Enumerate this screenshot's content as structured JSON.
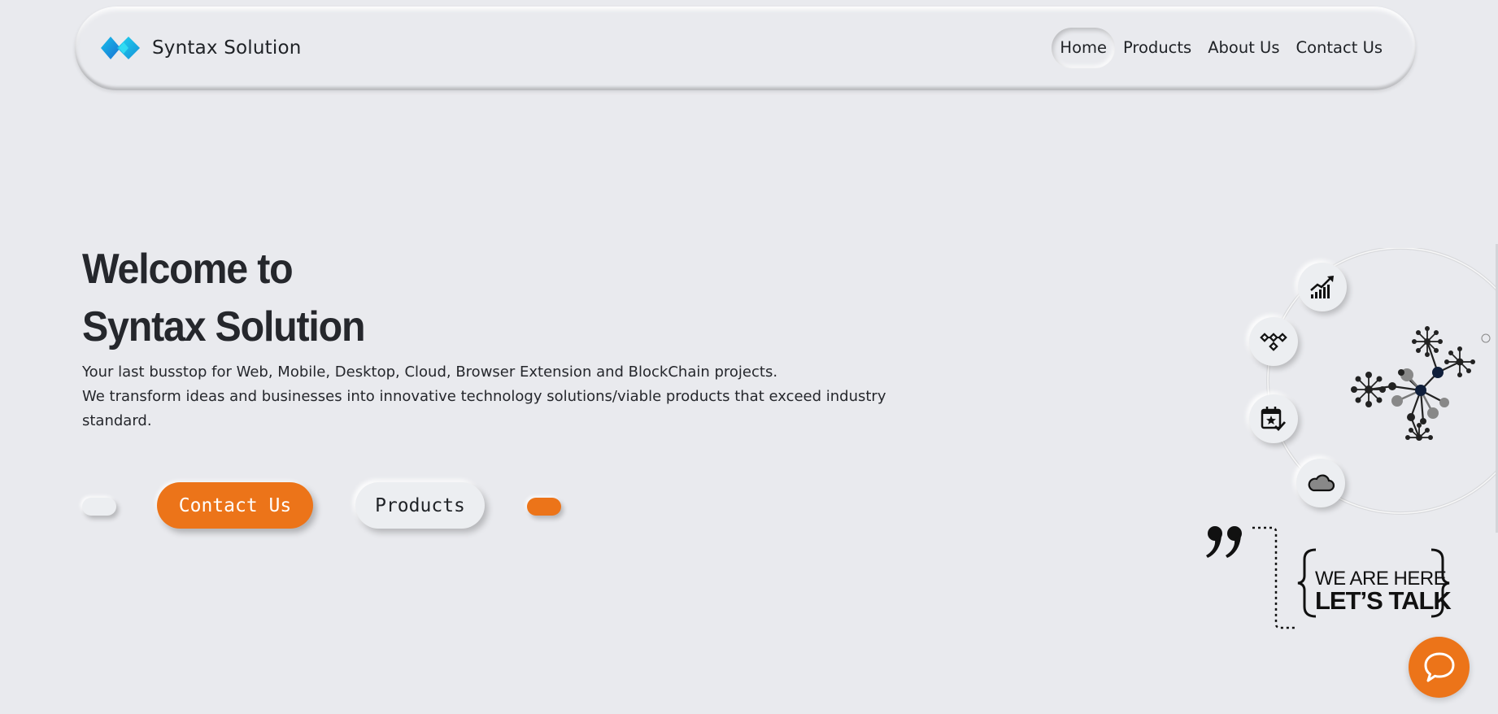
{
  "navbar": {
    "brand_name": "Syntax Solution",
    "logo_icon": "diamond-logo-icon",
    "links": [
      {
        "label": "Home",
        "active": true
      },
      {
        "label": "Products",
        "active": false
      },
      {
        "label": "About Us",
        "active": false
      },
      {
        "label": "Contact Us",
        "active": false
      }
    ]
  },
  "hero": {
    "title_line1": "Welcome to",
    "title_line2": "Syntax Solution",
    "description_line1": "Your last busstop for Web, Mobile, Desktop, Cloud, Browser Extension and BlockChain projects.",
    "description_line2": "We transform ideas and businesses into innovative technology solutions/viable products that exceed industry standard.",
    "contact_button": "Contact Us",
    "products_button": "Products"
  },
  "illustration": {
    "orbit_icons": [
      "chart-growth-icon",
      "blockchain-nodes-icon",
      "calendar-star-icon",
      "cloud-icon"
    ],
    "network_icon": "network-hub-icon",
    "quote_icon": "quote-mark-icon",
    "tagline_line1": "WE ARE HERE",
    "tagline_line2": "LET’S TALK"
  },
  "chat": {
    "icon": "chat-bubble-icon"
  },
  "colors": {
    "accent": "#ec7419",
    "background": "#e9eaee",
    "text": "#1f2226"
  }
}
